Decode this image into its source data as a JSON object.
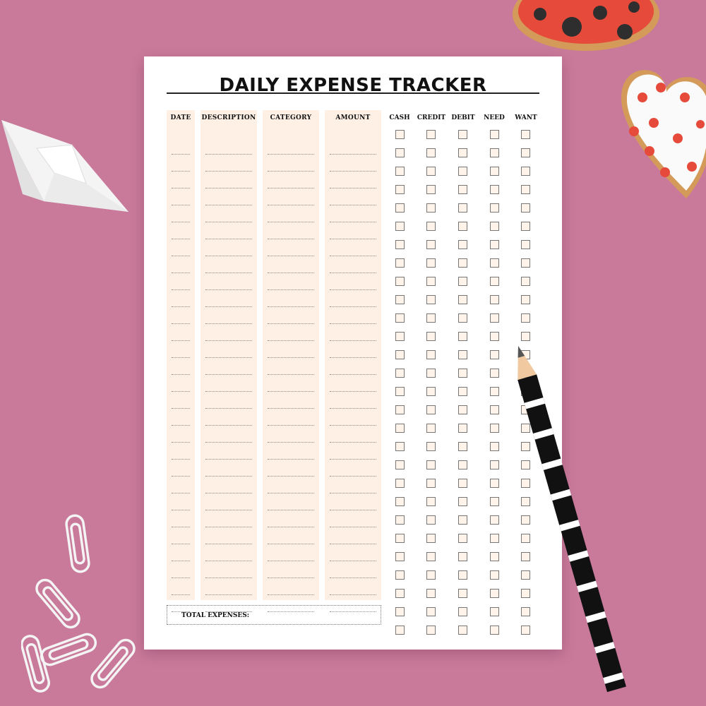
{
  "title": "DAILY EXPENSE TRACKER",
  "columns": {
    "date": "DATE",
    "description": "DESCRIPTION",
    "category": "CATEGORY",
    "amount": "AMOUNT"
  },
  "checkbox_columns": {
    "cash": "CASH",
    "credit": "CREDIT",
    "debit": "DEBIT",
    "need": "NEED",
    "want": "WANT"
  },
  "total_label": "TOTAL EXPENSES:",
  "rows": 28,
  "colors": {
    "background": "#c97a9a",
    "column_fill": "#fff0e6",
    "paper": "#ffffff"
  }
}
